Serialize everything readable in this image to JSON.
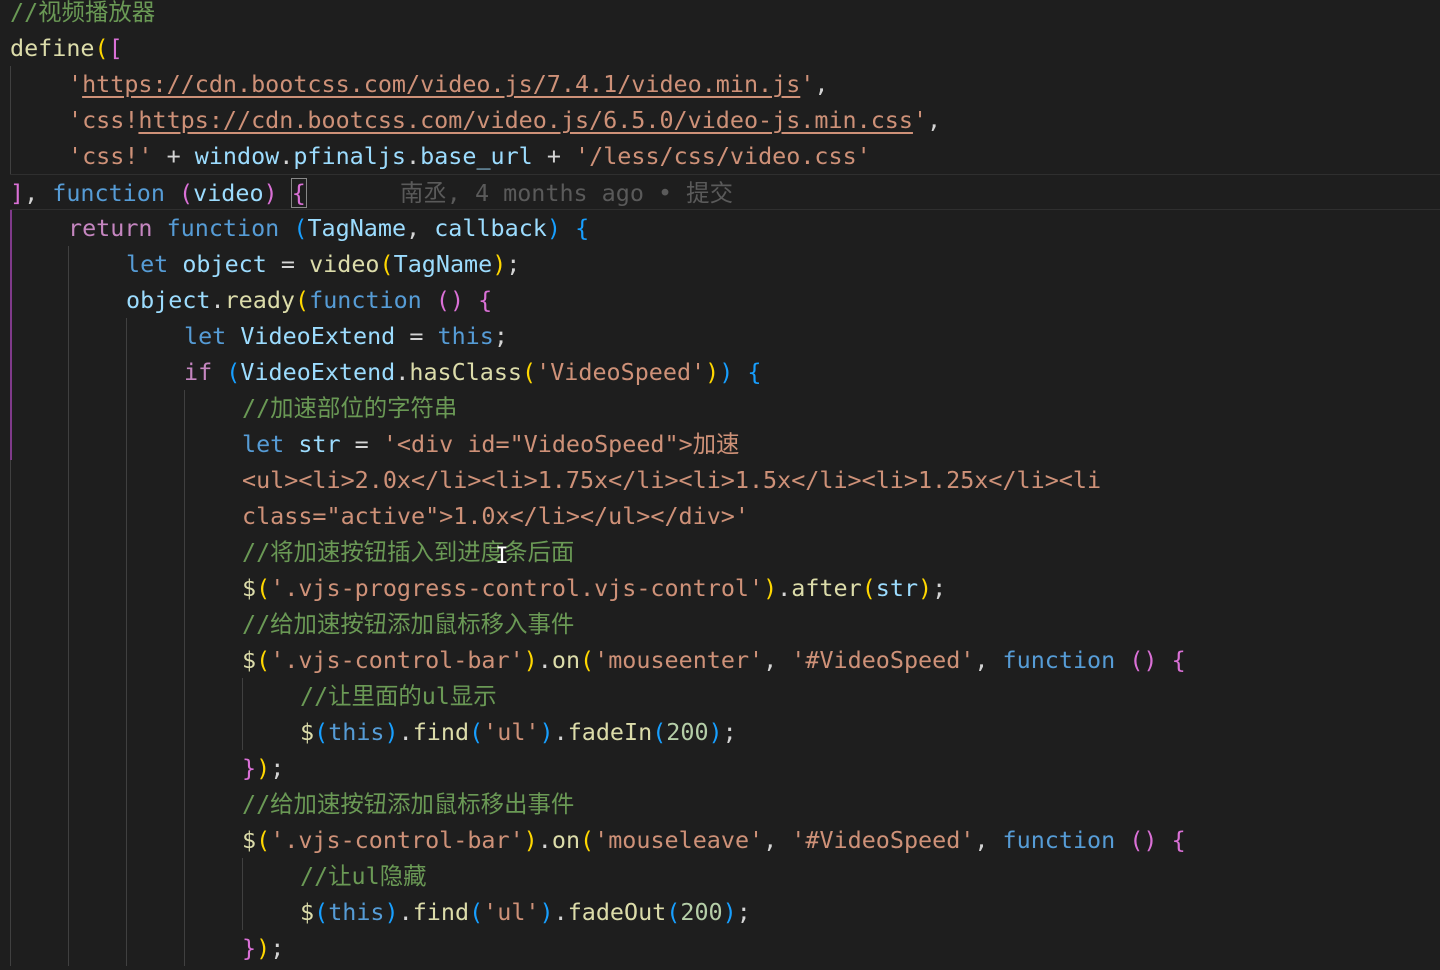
{
  "editor": {
    "blame": "南丞, 4 months ago • 提交",
    "lines": [
      {
        "indent": 0,
        "tokens": [
          {
            "t": "//视频播放器",
            "c": "c-com"
          }
        ]
      },
      {
        "indent": 0,
        "tokens": [
          {
            "t": "define",
            "c": "c-fn"
          },
          {
            "t": "(",
            "c": "b1"
          },
          {
            "t": "[",
            "c": "b2"
          }
        ]
      },
      {
        "indent": 1,
        "tokens": [
          {
            "t": "'",
            "c": "c-str"
          },
          {
            "t": "https://cdn.bootcss.com/video.js/7.4.1/video.min.js",
            "c": "c-str u"
          },
          {
            "t": "'",
            "c": "c-str"
          },
          {
            "t": ",",
            "c": "c-plain"
          }
        ]
      },
      {
        "indent": 1,
        "tokens": [
          {
            "t": "'css!",
            "c": "c-str"
          },
          {
            "t": "https://cdn.bootcss.com/video.js/6.5.0/video-js.min.css",
            "c": "c-str u"
          },
          {
            "t": "'",
            "c": "c-str"
          },
          {
            "t": ",",
            "c": "c-plain"
          }
        ]
      },
      {
        "indent": 1,
        "tokens": [
          {
            "t": "'css!'",
            "c": "c-str"
          },
          {
            "t": " + ",
            "c": "c-plain"
          },
          {
            "t": "window",
            "c": "c-var"
          },
          {
            "t": ".",
            "c": "c-plain"
          },
          {
            "t": "pfinaljs",
            "c": "c-var"
          },
          {
            "t": ".",
            "c": "c-plain"
          },
          {
            "t": "base_url",
            "c": "c-var"
          },
          {
            "t": " + ",
            "c": "c-plain"
          },
          {
            "t": "'/less/css/video.css'",
            "c": "c-str"
          }
        ]
      },
      {
        "indent": 0,
        "current": true,
        "blame": true,
        "tokens": [
          {
            "t": "]",
            "c": "b2"
          },
          {
            "t": ", ",
            "c": "c-plain"
          },
          {
            "t": "function",
            "c": "c-kw"
          },
          {
            "t": " ",
            "c": "c-plain"
          },
          {
            "t": "(",
            "c": "b2"
          },
          {
            "t": "video",
            "c": "c-var"
          },
          {
            "t": ")",
            "c": "b2"
          },
          {
            "t": " ",
            "c": "c-plain"
          },
          {
            "t": "{",
            "c": "b2 bracket-box"
          }
        ]
      },
      {
        "indent": 1,
        "tokens": [
          {
            "t": "return",
            "c": "c-ctl"
          },
          {
            "t": " ",
            "c": "c-plain"
          },
          {
            "t": "function",
            "c": "c-kw"
          },
          {
            "t": " ",
            "c": "c-plain"
          },
          {
            "t": "(",
            "c": "b3"
          },
          {
            "t": "TagName",
            "c": "c-var"
          },
          {
            "t": ", ",
            "c": "c-plain"
          },
          {
            "t": "callback",
            "c": "c-var"
          },
          {
            "t": ")",
            "c": "b3"
          },
          {
            "t": " ",
            "c": "c-plain"
          },
          {
            "t": "{",
            "c": "b3"
          }
        ]
      },
      {
        "indent": 2,
        "tokens": [
          {
            "t": "let",
            "c": "c-kw"
          },
          {
            "t": " ",
            "c": "c-plain"
          },
          {
            "t": "object",
            "c": "c-var"
          },
          {
            "t": " = ",
            "c": "c-plain"
          },
          {
            "t": "video",
            "c": "c-fn"
          },
          {
            "t": "(",
            "c": "b1"
          },
          {
            "t": "TagName",
            "c": "c-var"
          },
          {
            "t": ")",
            "c": "b1"
          },
          {
            "t": ";",
            "c": "c-plain"
          }
        ]
      },
      {
        "indent": 2,
        "tokens": [
          {
            "t": "object",
            "c": "c-var"
          },
          {
            "t": ".",
            "c": "c-plain"
          },
          {
            "t": "ready",
            "c": "c-fn"
          },
          {
            "t": "(",
            "c": "b1"
          },
          {
            "t": "function",
            "c": "c-kw"
          },
          {
            "t": " ",
            "c": "c-plain"
          },
          {
            "t": "(",
            "c": "b2"
          },
          {
            "t": ")",
            "c": "b2"
          },
          {
            "t": " ",
            "c": "c-plain"
          },
          {
            "t": "{",
            "c": "b2"
          }
        ]
      },
      {
        "indent": 3,
        "tokens": [
          {
            "t": "let",
            "c": "c-kw"
          },
          {
            "t": " ",
            "c": "c-plain"
          },
          {
            "t": "VideoExtend",
            "c": "c-var"
          },
          {
            "t": " = ",
            "c": "c-plain"
          },
          {
            "t": "this",
            "c": "c-kw"
          },
          {
            "t": ";",
            "c": "c-plain"
          }
        ]
      },
      {
        "indent": 3,
        "tokens": [
          {
            "t": "if",
            "c": "c-ctl"
          },
          {
            "t": " ",
            "c": "c-plain"
          },
          {
            "t": "(",
            "c": "b3"
          },
          {
            "t": "VideoExtend",
            "c": "c-var"
          },
          {
            "t": ".",
            "c": "c-plain"
          },
          {
            "t": "hasClass",
            "c": "c-fn"
          },
          {
            "t": "(",
            "c": "b1"
          },
          {
            "t": "'VideoSpeed'",
            "c": "c-str"
          },
          {
            "t": ")",
            "c": "b1"
          },
          {
            "t": ")",
            "c": "b3"
          },
          {
            "t": " ",
            "c": "c-plain"
          },
          {
            "t": "{",
            "c": "b3"
          }
        ]
      },
      {
        "indent": 4,
        "tokens": [
          {
            "t": "//加速部位的字符串",
            "c": "c-com"
          }
        ]
      },
      {
        "indent": 4,
        "tokens": [
          {
            "t": "let",
            "c": "c-kw"
          },
          {
            "t": " ",
            "c": "c-plain"
          },
          {
            "t": "str",
            "c": "c-var"
          },
          {
            "t": " = ",
            "c": "c-plain"
          },
          {
            "t": "'<div id=\"VideoSpeed\">加速",
            "c": "c-str"
          }
        ]
      },
      {
        "indent": 4,
        "tokens": [
          {
            "t": "<ul><li>2.0x</li><li>1.75x</li><li>1.5x</li><li>1.25x</li><li",
            "c": "c-str"
          }
        ]
      },
      {
        "indent": 4,
        "tokens": [
          {
            "t": "class=\"active\">1.0x</li></ul></div>'",
            "c": "c-str"
          }
        ]
      },
      {
        "indent": 4,
        "tokens": [
          {
            "t": "//将加速按钮插入到进度条后面",
            "c": "c-com"
          }
        ]
      },
      {
        "indent": 4,
        "tokens": [
          {
            "t": "$",
            "c": "c-fn"
          },
          {
            "t": "(",
            "c": "b1"
          },
          {
            "t": "'.vjs-progress-control.vjs-control'",
            "c": "c-str"
          },
          {
            "t": ")",
            "c": "b1"
          },
          {
            "t": ".",
            "c": "c-plain"
          },
          {
            "t": "after",
            "c": "c-fn"
          },
          {
            "t": "(",
            "c": "b1"
          },
          {
            "t": "str",
            "c": "c-var"
          },
          {
            "t": ")",
            "c": "b1"
          },
          {
            "t": ";",
            "c": "c-plain"
          }
        ]
      },
      {
        "indent": 4,
        "tokens": [
          {
            "t": "//给加速按钮添加鼠标移入事件",
            "c": "c-com"
          }
        ]
      },
      {
        "indent": 4,
        "tokens": [
          {
            "t": "$",
            "c": "c-fn"
          },
          {
            "t": "(",
            "c": "b1"
          },
          {
            "t": "'.vjs-control-bar'",
            "c": "c-str"
          },
          {
            "t": ")",
            "c": "b1"
          },
          {
            "t": ".",
            "c": "c-plain"
          },
          {
            "t": "on",
            "c": "c-fn"
          },
          {
            "t": "(",
            "c": "b1"
          },
          {
            "t": "'mouseenter'",
            "c": "c-str"
          },
          {
            "t": ", ",
            "c": "c-plain"
          },
          {
            "t": "'#VideoSpeed'",
            "c": "c-str"
          },
          {
            "t": ", ",
            "c": "c-plain"
          },
          {
            "t": "function",
            "c": "c-kw"
          },
          {
            "t": " ",
            "c": "c-plain"
          },
          {
            "t": "(",
            "c": "b2"
          },
          {
            "t": ")",
            "c": "b2"
          },
          {
            "t": " ",
            "c": "c-plain"
          },
          {
            "t": "{",
            "c": "b2"
          }
        ]
      },
      {
        "indent": 5,
        "tokens": [
          {
            "t": "//让里面的ul显示",
            "c": "c-com"
          }
        ]
      },
      {
        "indent": 5,
        "tokens": [
          {
            "t": "$",
            "c": "c-fn"
          },
          {
            "t": "(",
            "c": "b3"
          },
          {
            "t": "this",
            "c": "c-kw"
          },
          {
            "t": ")",
            "c": "b3"
          },
          {
            "t": ".",
            "c": "c-plain"
          },
          {
            "t": "find",
            "c": "c-fn"
          },
          {
            "t": "(",
            "c": "b3"
          },
          {
            "t": "'ul'",
            "c": "c-str"
          },
          {
            "t": ")",
            "c": "b3"
          },
          {
            "t": ".",
            "c": "c-plain"
          },
          {
            "t": "fadeIn",
            "c": "c-fn"
          },
          {
            "t": "(",
            "c": "b3"
          },
          {
            "t": "200",
            "c": "c-num"
          },
          {
            "t": ")",
            "c": "b3"
          },
          {
            "t": ";",
            "c": "c-plain"
          }
        ]
      },
      {
        "indent": 4,
        "tokens": [
          {
            "t": "}",
            "c": "b2"
          },
          {
            "t": ")",
            "c": "b1"
          },
          {
            "t": ";",
            "c": "c-plain"
          }
        ]
      },
      {
        "indent": 4,
        "tokens": [
          {
            "t": "//给加速按钮添加鼠标移出事件",
            "c": "c-com"
          }
        ]
      },
      {
        "indent": 4,
        "tokens": [
          {
            "t": "$",
            "c": "c-fn"
          },
          {
            "t": "(",
            "c": "b1"
          },
          {
            "t": "'.vjs-control-bar'",
            "c": "c-str"
          },
          {
            "t": ")",
            "c": "b1"
          },
          {
            "t": ".",
            "c": "c-plain"
          },
          {
            "t": "on",
            "c": "c-fn"
          },
          {
            "t": "(",
            "c": "b1"
          },
          {
            "t": "'mouseleave'",
            "c": "c-str"
          },
          {
            "t": ", ",
            "c": "c-plain"
          },
          {
            "t": "'#VideoSpeed'",
            "c": "c-str"
          },
          {
            "t": ", ",
            "c": "c-plain"
          },
          {
            "t": "function",
            "c": "c-kw"
          },
          {
            "t": " ",
            "c": "c-plain"
          },
          {
            "t": "(",
            "c": "b2"
          },
          {
            "t": ")",
            "c": "b2"
          },
          {
            "t": " ",
            "c": "c-plain"
          },
          {
            "t": "{",
            "c": "b2"
          }
        ]
      },
      {
        "indent": 5,
        "tokens": [
          {
            "t": "//让ul隐藏",
            "c": "c-com"
          }
        ]
      },
      {
        "indent": 5,
        "tokens": [
          {
            "t": "$",
            "c": "c-fn"
          },
          {
            "t": "(",
            "c": "b3"
          },
          {
            "t": "this",
            "c": "c-kw"
          },
          {
            "t": ")",
            "c": "b3"
          },
          {
            "t": ".",
            "c": "c-plain"
          },
          {
            "t": "find",
            "c": "c-fn"
          },
          {
            "t": "(",
            "c": "b3"
          },
          {
            "t": "'ul'",
            "c": "c-str"
          },
          {
            "t": ")",
            "c": "b3"
          },
          {
            "t": ".",
            "c": "c-plain"
          },
          {
            "t": "fadeOut",
            "c": "c-fn"
          },
          {
            "t": "(",
            "c": "b3"
          },
          {
            "t": "200",
            "c": "c-num"
          },
          {
            "t": ")",
            "c": "b3"
          },
          {
            "t": ";",
            "c": "c-plain"
          }
        ]
      },
      {
        "indent": 4,
        "tokens": [
          {
            "t": "}",
            "c": "b2"
          },
          {
            "t": ")",
            "c": "b1"
          },
          {
            "t": ";",
            "c": "c-plain"
          }
        ]
      }
    ]
  },
  "cursor": {
    "icon": "ibeam-cursor-icon",
    "glyph": "I"
  }
}
